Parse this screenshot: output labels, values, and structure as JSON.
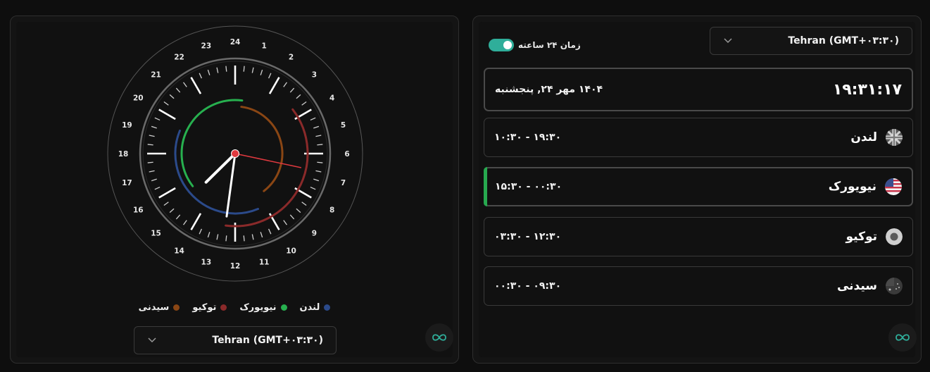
{
  "clock": {
    "hour_labels": [
      "24",
      "1",
      "2",
      "3",
      "4",
      "5",
      "6",
      "7",
      "8",
      "9",
      "10",
      "11",
      "12",
      "13",
      "14",
      "15",
      "16",
      "17",
      "18",
      "19",
      "20",
      "21",
      "22",
      "23"
    ],
    "time": {
      "hours": 19,
      "minutes": 31,
      "seconds": 17
    },
    "arcs": [
      {
        "name": "لندن",
        "color": "#2b4a8a",
        "start": "10:30",
        "end": "19:30"
      },
      {
        "name": "نیویورک",
        "color": "#27b04f",
        "start": "15:30",
        "end": "00:30"
      },
      {
        "name": "توکیو",
        "color": "#8a2a2a",
        "start": "03:30",
        "end": "12:30"
      },
      {
        "name": "سیدنی",
        "color": "#8a4614",
        "start": "00:30",
        "end": "09:30"
      }
    ],
    "colors": {
      "hour_hand": "#ffffff",
      "minute_hand": "#ffffff",
      "second_hand": "#e0393f",
      "center": "#e0393f"
    }
  },
  "legend": [
    {
      "label": "لندن",
      "color": "#2b4a8a"
    },
    {
      "label": "نیویورک",
      "color": "#27b04f"
    },
    {
      "label": "توکیو",
      "color": "#8a2a2a"
    },
    {
      "label": "سیدنی",
      "color": "#8a4614"
    }
  ],
  "left_select": {
    "value": "Tehran (GMT+۰۳:۳۰)"
  },
  "right_select": {
    "value": "Tehran (GMT+۰۳:۳۰)"
  },
  "toggle": {
    "label": "زمان ۲۴ ساعته",
    "on": true
  },
  "main_card": {
    "time": "۱۹:۳۱:۱۷",
    "date": "۱۴۰۴ مهر ۲۴, پنجشنبه"
  },
  "cities": [
    {
      "name": "لندن",
      "range": "۱۰:۳۰ - ۱۹:۳۰",
      "flag": "uk-flag-icon",
      "active": false
    },
    {
      "name": "نیویورک",
      "range": "۱۵:۳۰ - ۰۰:۳۰",
      "flag": "us-flag-icon",
      "active": true
    },
    {
      "name": "توکیو",
      "range": "۰۳:۳۰ - ۱۲:۳۰",
      "flag": "japan-flag-icon",
      "active": false
    },
    {
      "name": "سیدنی",
      "range": "۰۰:۳۰ - ۰۹:۳۰",
      "flag": "australia-flag-icon",
      "active": false
    }
  ],
  "brand_icon": "infinity-logo-icon"
}
